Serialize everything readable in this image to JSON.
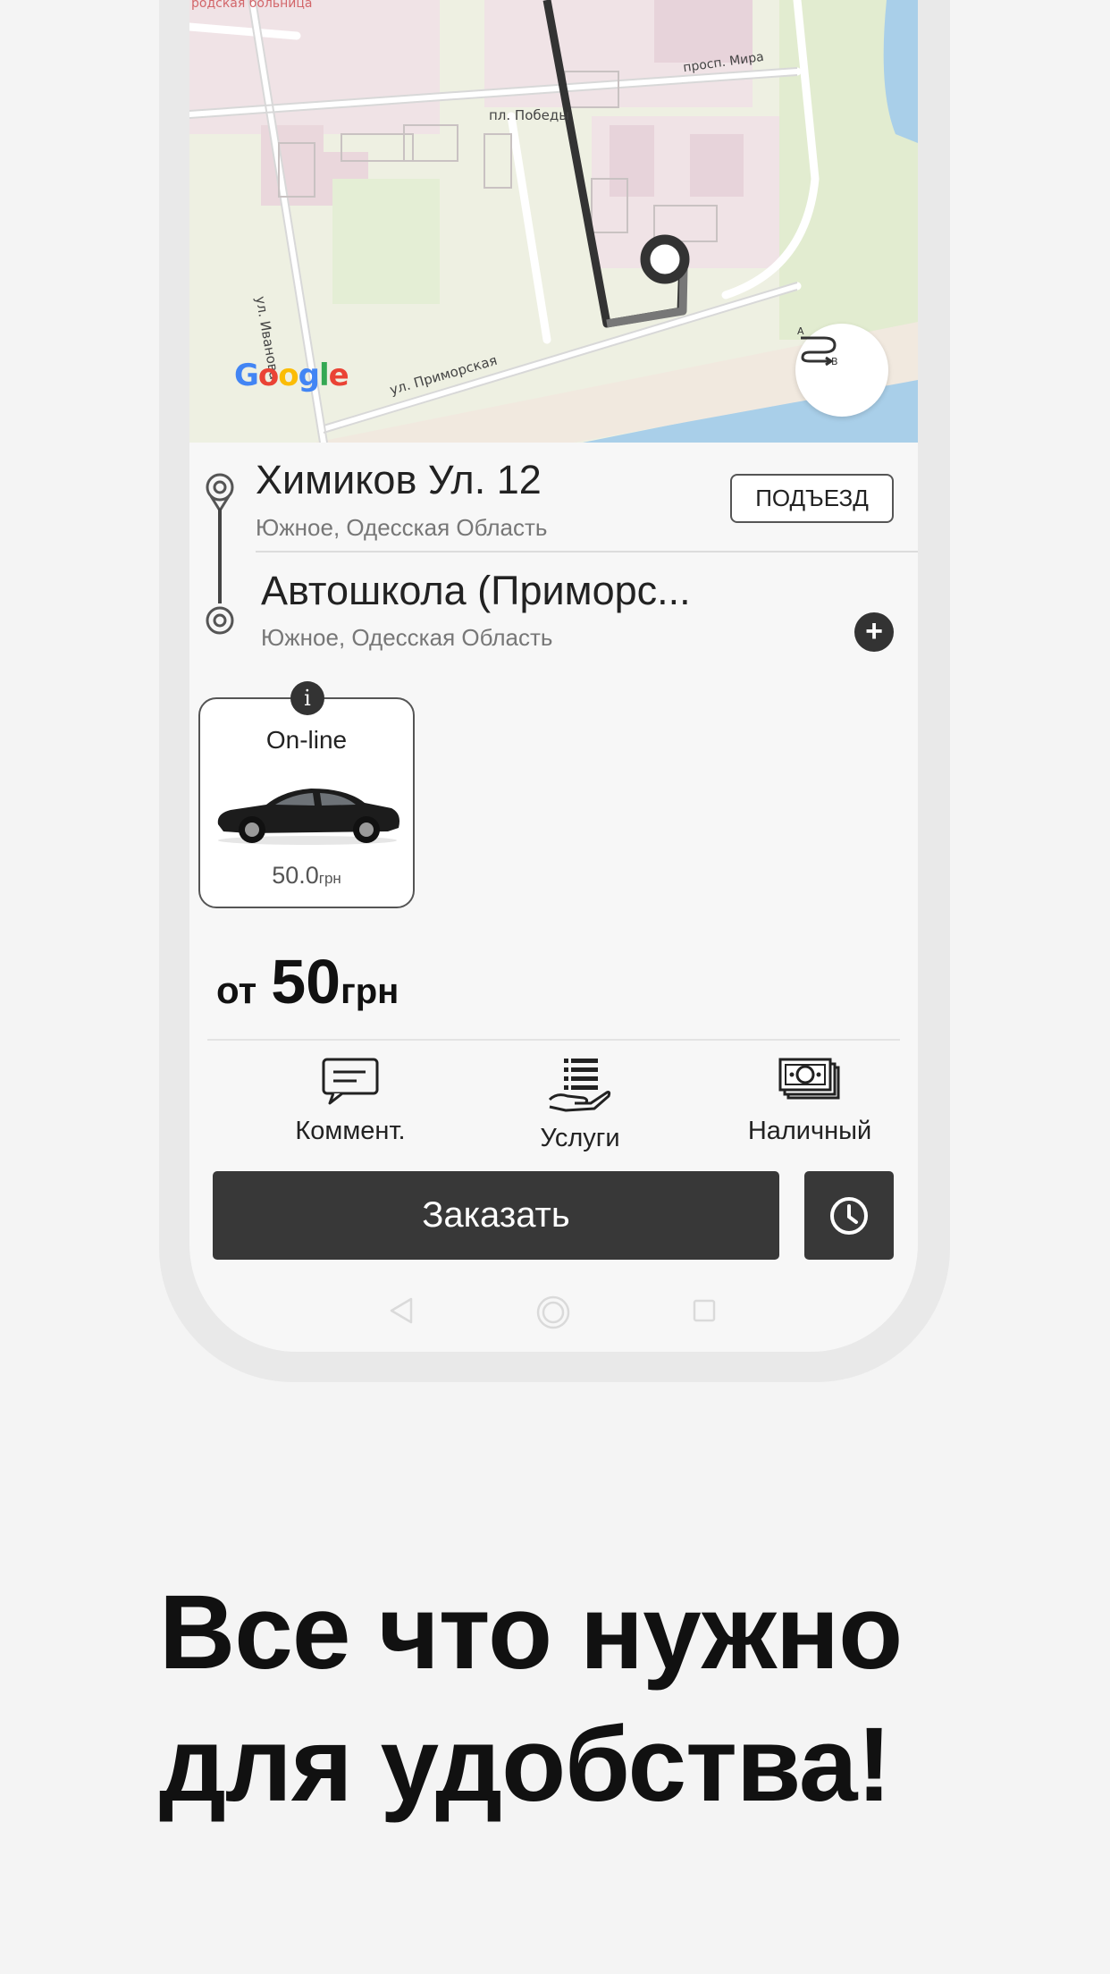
{
  "map": {
    "labels": {
      "hospital": "родская больница",
      "prospekt": "просп. Мира",
      "square": "пл. Победы",
      "ivanova": "ул. Иванова",
      "primorskaya": "ул. Приморская"
    },
    "google_logo": {
      "G": "G",
      "o1": "o",
      "o2": "o",
      "g": "g",
      "l": "l",
      "e": "e"
    },
    "route_button_icon": "route-ab-icon"
  },
  "route": {
    "from": {
      "title": "Химиков Ул. 12",
      "subtitle": "Южное, Одесская Область"
    },
    "to": {
      "title": "Автошкола (Приморс...",
      "subtitle": "Южное, Одесская Область"
    },
    "entrance_label": "ПОДЪЕЗД",
    "add_stop_label": "+"
  },
  "tariff": {
    "info_label": "i",
    "name": "On-line",
    "price": "50.0",
    "currency": "грн"
  },
  "price": {
    "prefix": "от",
    "amount": "50",
    "currency": "грн"
  },
  "options": [
    {
      "label": "Коммент.",
      "icon": "comment-icon"
    },
    {
      "label": "Услуги",
      "icon": "services-icon"
    },
    {
      "label": "Наличный",
      "icon": "cash-icon"
    }
  ],
  "actions": {
    "order_label": "Заказать",
    "schedule_icon": "clock-icon"
  },
  "headline": {
    "line1": "Все что нужно",
    "line2": "для удобства!"
  },
  "colors": {
    "accent": "#383838",
    "background": "#f4f4f4",
    "route_line": "#333333"
  }
}
